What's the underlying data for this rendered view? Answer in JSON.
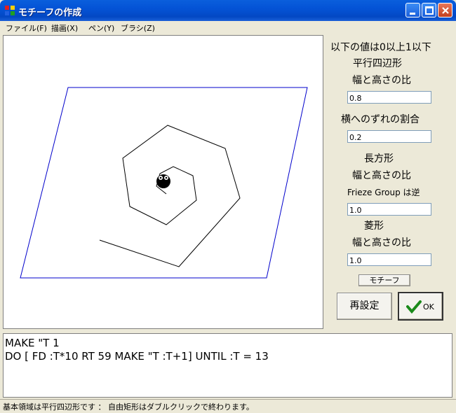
{
  "window": {
    "title": "モチーフの作成"
  },
  "menu": [
    "ファイル(F)",
    "描画(X)",
    "ペン(Y)",
    "ブラシ(Z)"
  ],
  "panel": {
    "header": "以下の値は0以上1以下",
    "parallelogram_label": "平行四辺形",
    "ratio_label_1": "幅と高さの比",
    "ratio_value_1": "0.8",
    "shift_label": "横へのずれの割合",
    "shift_value": "0.2",
    "rectangle_label": "長方形",
    "ratio_label_2": "幅と高さの比",
    "frieze_label": "Frieze Group は逆",
    "frieze_value": "1.0",
    "rhombus_label": "菱形",
    "ratio_label_3": "幅と高さの比",
    "rhombus_value": "1.0",
    "motif_button": "モチーフ",
    "reset_button": "再設定",
    "ok_button": "OK"
  },
  "code": {
    "line1": "MAKE \"T 1",
    "line2": "DO [ FD :T*10 RT 59 MAKE \"T :T+1] UNTIL :T = 13"
  },
  "status": "基本領域は平行四辺形です ： 自由矩形はダブルクリックで終わります。",
  "colors": {
    "parallelogram": "#0000cc",
    "spiral": "#000000"
  }
}
